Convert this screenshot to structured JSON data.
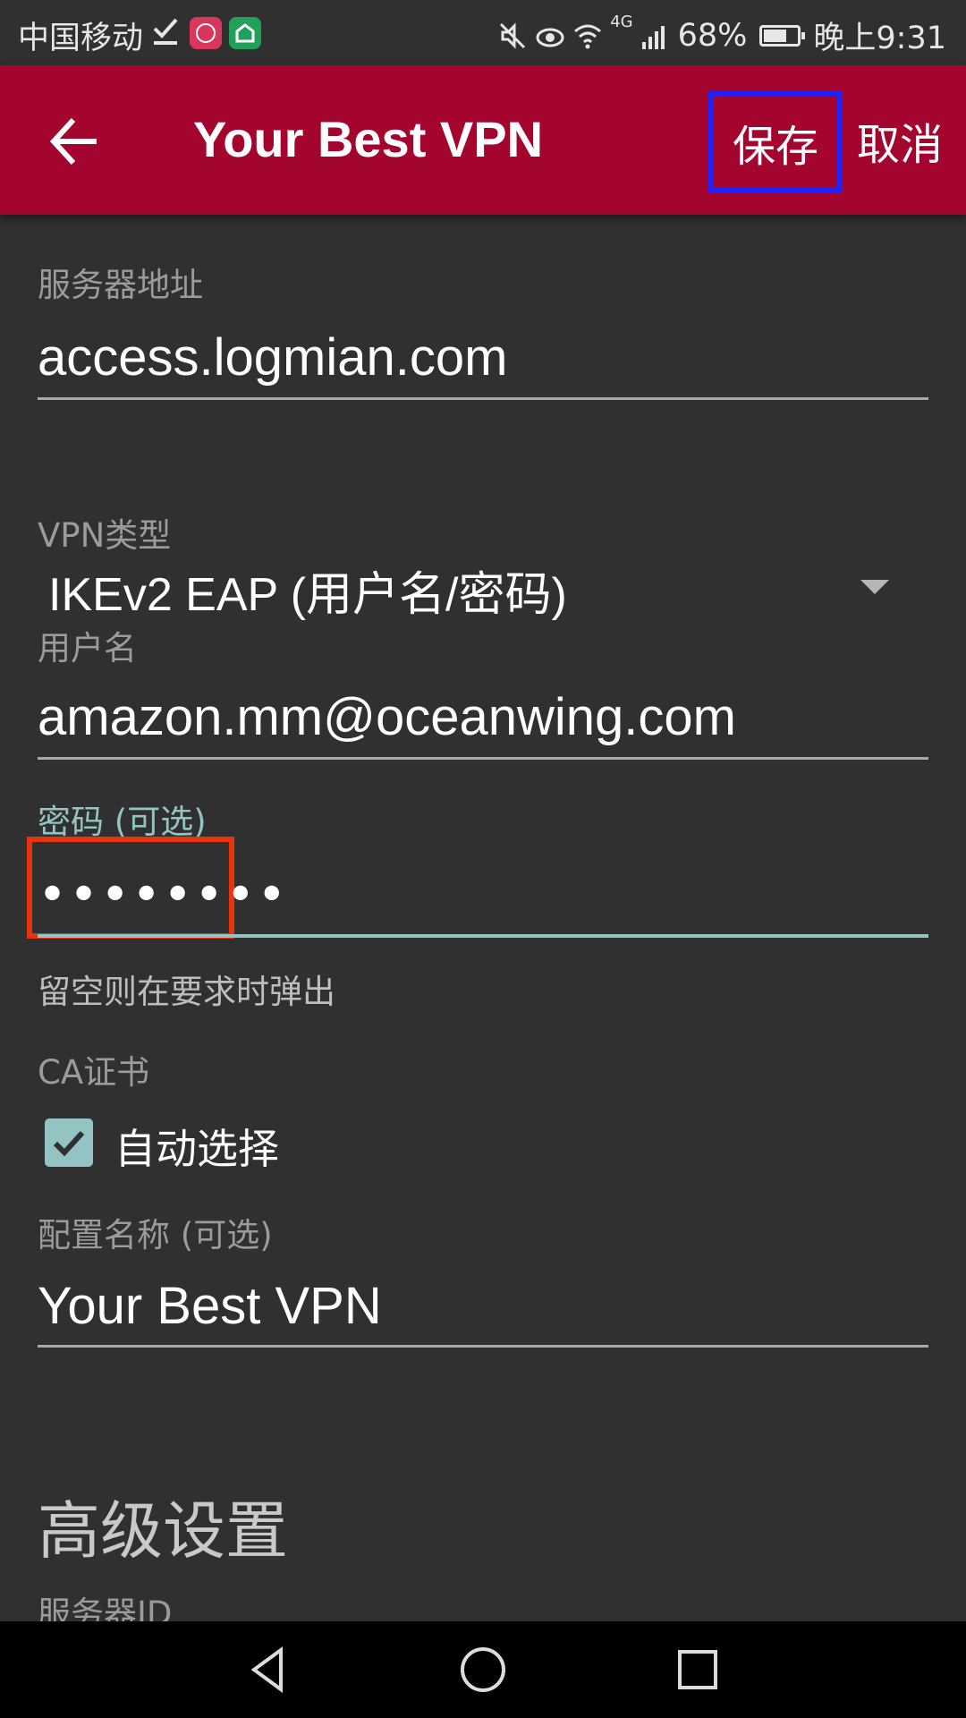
{
  "status_bar": {
    "carrier": "中国移动",
    "network": "4G",
    "battery": "68%",
    "time": "晚上9:31"
  },
  "app_bar": {
    "title": "Your Best VPN",
    "save_label": "保存",
    "cancel_label": "取消"
  },
  "form": {
    "server_address": {
      "label": "服务器地址",
      "value": "access.logmian.com"
    },
    "vpn_type": {
      "label": "VPN类型",
      "value": "IKEv2 EAP (用户名/密码)"
    },
    "username": {
      "label": "用户名",
      "value": "amazon.mm@oceanwing.com"
    },
    "password": {
      "label": "密码 (可选)",
      "value": "••••••••",
      "hint": "留空则在要求时弹出"
    },
    "ca_cert": {
      "label": "CA证书",
      "checkbox_label": "自动选择",
      "checked": true
    },
    "profile_name": {
      "label": "配置名称 (可选)",
      "value": "Your Best VPN"
    }
  },
  "advanced": {
    "title": "高级设置",
    "server_id_label": "服务器ID"
  },
  "colors": {
    "app_bar": "#a3052e",
    "background": "#303030",
    "accent": "#94c3c3",
    "highlight_blue": "#1f22ff",
    "highlight_red": "#e8330c"
  }
}
